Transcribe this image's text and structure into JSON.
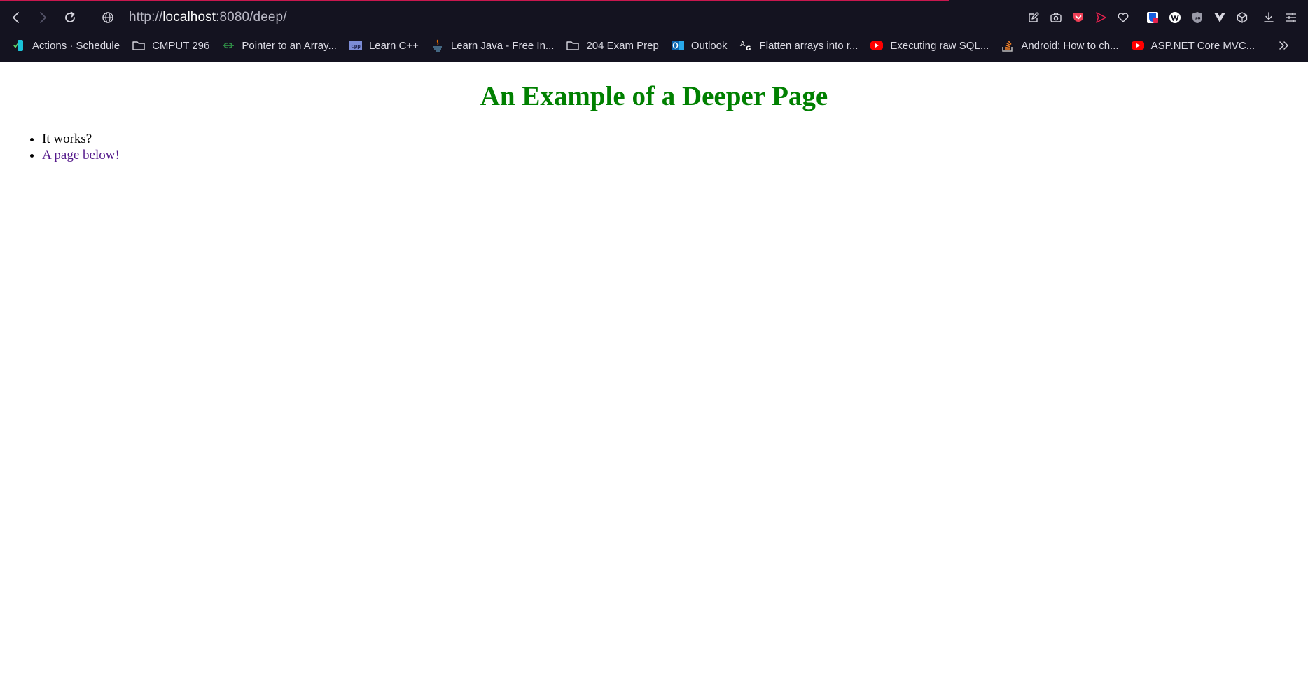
{
  "browser": {
    "address": {
      "prefix": "http://",
      "host": "localhost",
      "suffix": ":8080/deep/"
    },
    "colors": {
      "chrome_background": "#141320",
      "load_indicator": "#c8174e"
    },
    "toolbar_icons": [
      "back-icon",
      "forward-icon",
      "reload-icon",
      "site-info-icon"
    ],
    "extension_icons": [
      "edit-page-icon",
      "camera-icon",
      "pocket-icon",
      "send-icon",
      "heart-icon",
      "bitwarden-icon",
      "w-extension-icon",
      "ublock-icon",
      "vue-devtools-icon",
      "cube-icon",
      "downloads-icon",
      "menu-icon"
    ]
  },
  "bookmarks": [
    {
      "label": "Actions · Schedule",
      "icon": "schedule-icon"
    },
    {
      "label": "CMPUT 296",
      "icon": "folder-icon"
    },
    {
      "label": "Pointer to an Array...",
      "icon": "geeksforgeeks-icon"
    },
    {
      "label": "Learn C++",
      "icon": "cpp-icon"
    },
    {
      "label": "Learn Java - Free In...",
      "icon": "java-icon"
    },
    {
      "label": "204 Exam Prep",
      "icon": "folder-icon"
    },
    {
      "label": "Outlook",
      "icon": "outlook-icon"
    },
    {
      "label": "Flatten arrays into r...",
      "icon": "ag-icon"
    },
    {
      "label": "Executing raw SQL...",
      "icon": "youtube-icon"
    },
    {
      "label": "Android: How to ch...",
      "icon": "stackoverflow-icon"
    },
    {
      "label": "ASP.NET Core MVC...",
      "icon": "youtube-icon"
    }
  ],
  "page": {
    "title": "An Example of a Deeper Page",
    "title_color": "#008000",
    "items": [
      {
        "text": "It works?"
      },
      {
        "text": "A page below!",
        "link": true
      }
    ]
  }
}
